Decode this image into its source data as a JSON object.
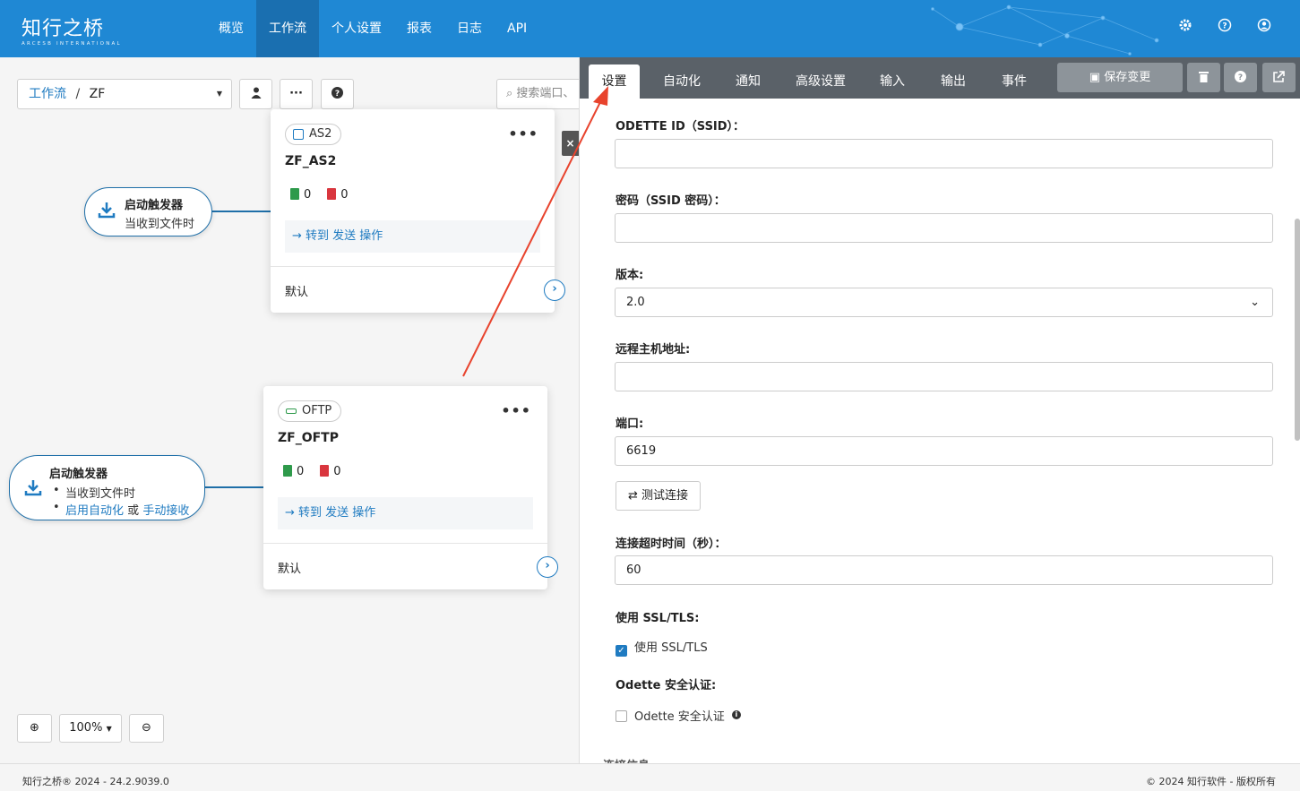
{
  "brand": {
    "name": "知行之桥",
    "tagline": "ARCESB INTERNATIONAL"
  },
  "nav": [
    "概览",
    "工作流",
    "个人设置",
    "报表",
    "日志",
    "API"
  ],
  "nav_active": "工作流",
  "top_icons": [
    "gear-icon",
    "help-icon",
    "user-icon"
  ],
  "breadcrumb": {
    "root": "工作流",
    "separator": "/",
    "current": "ZF"
  },
  "search": {
    "placeholder": "搜索端口、"
  },
  "triggers": [
    {
      "title": "启动触发器",
      "line": "当收到文件时"
    },
    {
      "title": "启动触发器",
      "bullet1": "当收到文件时",
      "link1": "启用自动化",
      "or": "或",
      "link2": "手动接收"
    }
  ],
  "cards": [
    {
      "type": "AS2",
      "name": "ZF_AS2",
      "ok_count": "0",
      "err_count": "0",
      "goto": "→ 转到 发送 操作",
      "default": "默认"
    },
    {
      "type": "OFTP",
      "name": "ZF_OFTP",
      "ok_count": "0",
      "err_count": "0",
      "goto": "→ 转到 发送 操作",
      "default": "默认"
    }
  ],
  "zoom": {
    "level": "100%"
  },
  "close_label": "×",
  "tabs": [
    "设置",
    "自动化",
    "通知",
    "高级设置",
    "输入",
    "输出",
    "事件"
  ],
  "tab_active": "设置",
  "save_label": "保存变更",
  "form": {
    "odette_id_label": "ODETTE ID（SSID）：",
    "odette_id_value": "",
    "password_label": "密码（SSID 密码）：",
    "password_value": "",
    "version_label": "版本:",
    "version_value": "2.0",
    "host_label": "远程主机地址:",
    "host_value": "",
    "port_label": "端口:",
    "port_value": "6619",
    "test_label": "测试连接",
    "timeout_label": "连接超时时间（秒）：",
    "timeout_value": "60",
    "ssl_label": "使用 SSL/TLS:",
    "ssl_checkbox": "使用 SSL/TLS",
    "ssl_checked": true,
    "auth_label": "Odette 安全认证:",
    "auth_checkbox": "Odette 安全认证",
    "auth_checked": false
  },
  "footer": {
    "left": "知行之桥® 2024 - 24.2.9039.0",
    "right": "© 2024 知行软件 - 版权所有"
  },
  "colors": {
    "nav": "#1f88d4",
    "accent": "#1f7bc1",
    "annotation": "#e8432d",
    "tabbar": "#5a6168"
  }
}
